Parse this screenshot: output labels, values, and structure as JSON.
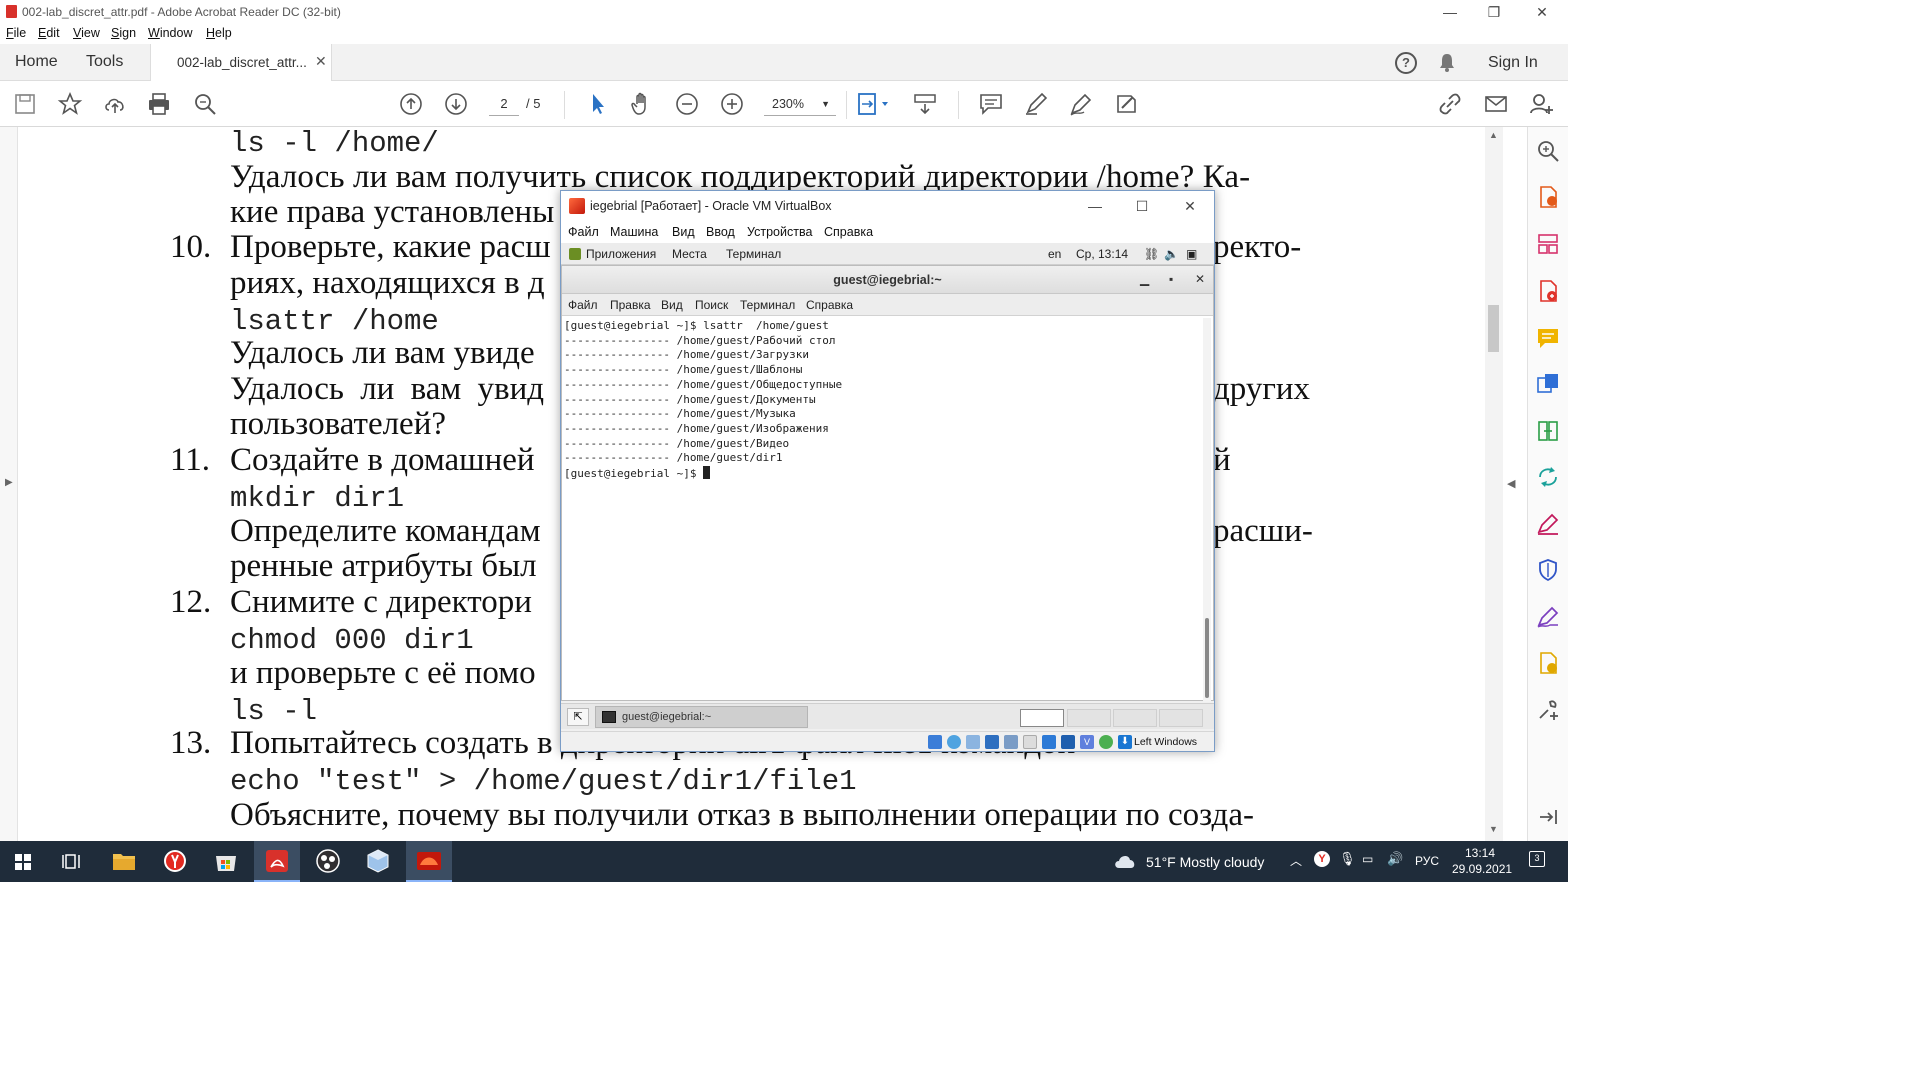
{
  "app": {
    "title": "002-lab_discret_attr.pdf - Adobe Acrobat Reader DC (32-bit)",
    "menu": [
      "File",
      "Edit",
      "View",
      "Sign",
      "Window",
      "Help"
    ],
    "nav_tabs": [
      "Home",
      "Tools"
    ],
    "doc_tab": "002-lab_discret_attr...",
    "sign_in": "Sign In"
  },
  "toolbar": {
    "page_current": "2",
    "page_total": "/ 5",
    "zoom": "230%"
  },
  "document": {
    "lines": [
      {
        "num": "",
        "text": "ls -l /home/",
        "mono": true
      },
      {
        "num": "",
        "text": "Удалось ли вам получить список поддиректорий директории /home? Ка-",
        "mono": false
      },
      {
        "num": "",
        "text": "кие права установлены",
        "mono": false
      },
      {
        "num": "10.",
        "text": "Проверьте, какие расш",
        "mono": false,
        "tail": "ректо-"
      },
      {
        "num": "",
        "text": "риях, находящихся в д",
        "mono": false
      },
      {
        "num": "",
        "text": "lsattr /home",
        "mono": true
      },
      {
        "num": "",
        "text": "Удалось ли вам увиде",
        "mono": false
      },
      {
        "num": "",
        "text": "Удалось ли вам увид",
        "mono": false,
        "tail": "других"
      },
      {
        "num": "",
        "text": "пользователей?",
        "mono": false
      },
      {
        "num": "11.",
        "text": "Создайте в домашней",
        "mono": false,
        "tail": "й"
      },
      {
        "num": "",
        "text": "mkdir dir1",
        "mono": true
      },
      {
        "num": "",
        "text": "Определите командам",
        "mono": false,
        "tail": "расши-"
      },
      {
        "num": "",
        "text": "ренные атрибуты был",
        "mono": false
      },
      {
        "num": "12.",
        "text": "Снимите с директори",
        "mono": false
      },
      {
        "num": "",
        "text": "chmod 000 dir1",
        "mono": true
      },
      {
        "num": "",
        "text": "и проверьте с её помо",
        "mono": false
      },
      {
        "num": "",
        "text": "ls -l",
        "mono": true
      },
      {
        "num": "13.",
        "text": "Попытайтесь создать в директории dir1 файл file1 командой",
        "mono": false
      },
      {
        "num": "",
        "text": "echo \"test\" > /home/guest/dir1/file1",
        "mono": true
      },
      {
        "num": "",
        "text": "Объясните, почему вы получили отказ в выполнении операции по созда-",
        "mono": false
      }
    ]
  },
  "vbox": {
    "title": "iegebrial [Работает] - Oracle VM VirtualBox",
    "menu": [
      "Файл",
      "Машина",
      "Вид",
      "Ввод",
      "Устройства",
      "Справка"
    ],
    "gnome_top": {
      "apps": "Приложения",
      "places": "Места",
      "terminal": "Терминал",
      "lang": "en",
      "clock": "Ср, 13:14"
    },
    "terminal": {
      "title": "guest@iegebrial:~",
      "menu": [
        "Файл",
        "Правка",
        "Вид",
        "Поиск",
        "Терминал",
        "Справка"
      ],
      "lines": [
        "[guest@iegebrial ~]$ lsattr  /home/guest",
        "---------------- /home/guest/Рабочий стол",
        "---------------- /home/guest/Загрузки",
        "---------------- /home/guest/Шаблоны",
        "---------------- /home/guest/Общедоступные",
        "---------------- /home/guest/Документы",
        "---------------- /home/guest/Музыка",
        "---------------- /home/guest/Изображения",
        "---------------- /home/guest/Видео",
        "---------------- /home/guest/dir1"
      ],
      "prompt": "[guest@iegebrial ~]$ "
    },
    "taskbar_item": "guest@iegebrial:~",
    "host_key": "Left Windows"
  },
  "taskbar": {
    "weather": "51°F  Mostly cloudy",
    "lang": "РУС",
    "time": "13:14",
    "date": "29.09.2021",
    "notifications": "3"
  },
  "colors": {
    "acrobat_red": "#d8312b",
    "taskbar": "#1f2c3a",
    "accent_blue": "#2a72c4",
    "right_panel_icons": "#e35a1a"
  }
}
